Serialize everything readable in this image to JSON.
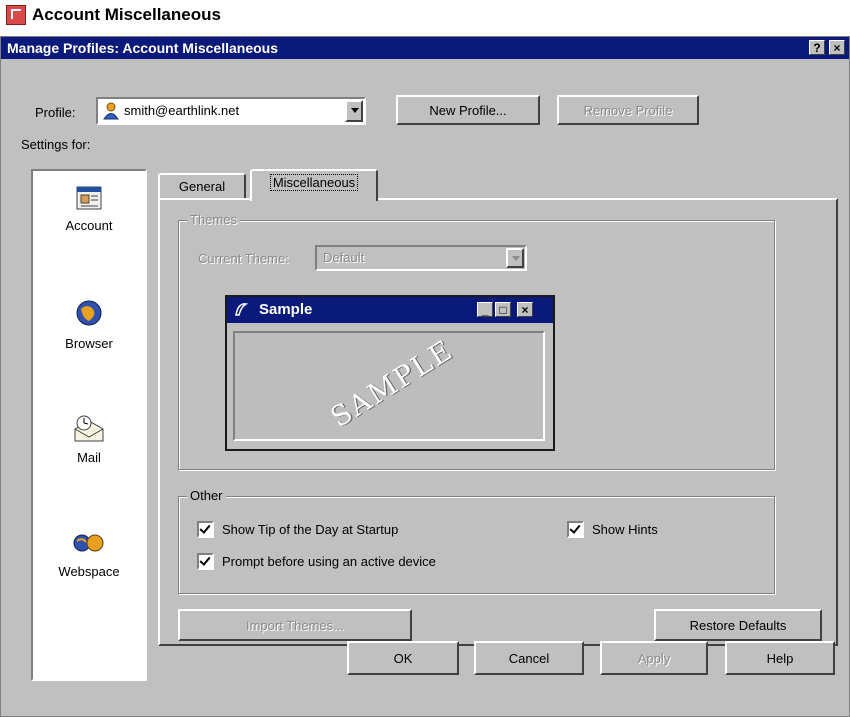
{
  "doc_title": "Account Miscellaneous",
  "window": {
    "title": "Manage Profiles: Account Miscellaneous",
    "help_btn": "?",
    "close_btn": "×"
  },
  "profile": {
    "label": "Profile:",
    "value": "smith@earthlink.net",
    "new_button": "New Profile...",
    "remove_button": "Remove Profile"
  },
  "settings_for_label": "Settings for:",
  "nav": [
    {
      "label": "Account",
      "selected": true
    },
    {
      "label": "Browser"
    },
    {
      "label": "Mail"
    },
    {
      "label": "Webspace"
    }
  ],
  "tabs": [
    {
      "label": "General"
    },
    {
      "label": "Miscellaneous",
      "active": true
    }
  ],
  "themes": {
    "group_label": "Themes",
    "current_label": "Current Theme:",
    "current_value": "Default",
    "sample_title": "Sample",
    "sample_watermark": "SAMPLE"
  },
  "other": {
    "group_label": "Other",
    "show_tip": "Show Tip of the Day at Startup",
    "show_hints": "Show Hints",
    "prompt_device": "Prompt before using an active device"
  },
  "import_button": "Import Themes...",
  "restore_button": "Restore Defaults",
  "footer": {
    "ok": "OK",
    "cancel": "Cancel",
    "apply": "Apply",
    "help": "Help"
  }
}
